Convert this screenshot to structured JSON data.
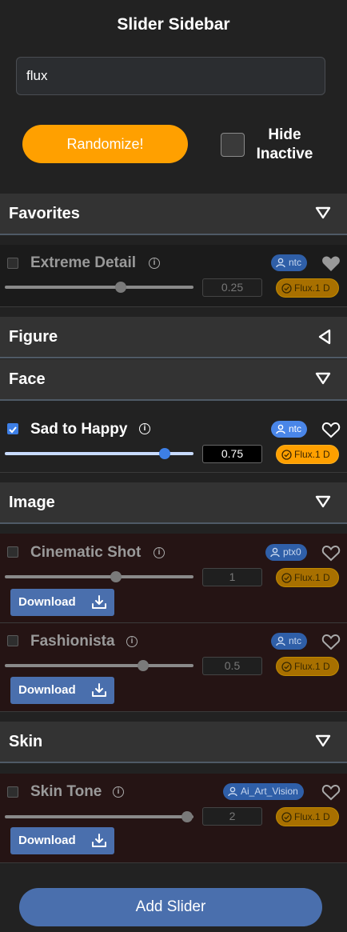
{
  "header": {
    "title": "Slider Sidebar"
  },
  "search": {
    "value": "flux"
  },
  "controls": {
    "randomize_label": "Randomize!",
    "hide_inactive_label": "Hide Inactive",
    "hide_inactive_checked": false
  },
  "sections": [
    {
      "label": "Favorites",
      "expanded": true
    },
    {
      "label": "Figure",
      "expanded": false
    },
    {
      "label": "Face",
      "expanded": true
    },
    {
      "label": "Image",
      "expanded": true
    },
    {
      "label": "Skin",
      "expanded": true
    }
  ],
  "sliders": [
    {
      "name": "Extreme Detail",
      "author": "ntc",
      "model": "Flux.1 D",
      "value": "0.25",
      "enabled": false,
      "favorite": true,
      "slider_fraction": 0.62,
      "download_label": ""
    },
    {
      "name": "Sad to Happy",
      "author": "ntc",
      "model": "Flux.1 D",
      "value": "0.75",
      "enabled": true,
      "favorite": false,
      "slider_fraction": 0.85,
      "download_label": ""
    },
    {
      "name": "Cinematic Shot",
      "author": "ptx0",
      "model": "Flux.1 D",
      "value": "1",
      "enabled": false,
      "favorite": false,
      "slider_fraction": 0.6,
      "download_label": "Download"
    },
    {
      "name": "Fashionista",
      "author": "ntc",
      "model": "Flux.1 D",
      "value": "0.5",
      "enabled": false,
      "favorite": false,
      "slider_fraction": 0.74,
      "download_label": "Download"
    },
    {
      "name": "Skin Tone",
      "author": "Ai_Art_Vision",
      "model": "Flux.1 D",
      "value": "2",
      "enabled": false,
      "favorite": false,
      "slider_fraction": 0.97,
      "download_label": "Download"
    }
  ],
  "footer": {
    "add_label": "Add Slider"
  },
  "icons": {
    "section_toggle": "triangle-icon",
    "info": "info-icon",
    "user": "user-icon",
    "verified": "check-circle-icon",
    "favorite": "heart-icon",
    "download": "download-icon"
  },
  "colors": {
    "accent_orange": "#ffa000",
    "accent_blue": "#3d7fe6",
    "button_blue": "#4a6fad",
    "background": "#222222"
  }
}
